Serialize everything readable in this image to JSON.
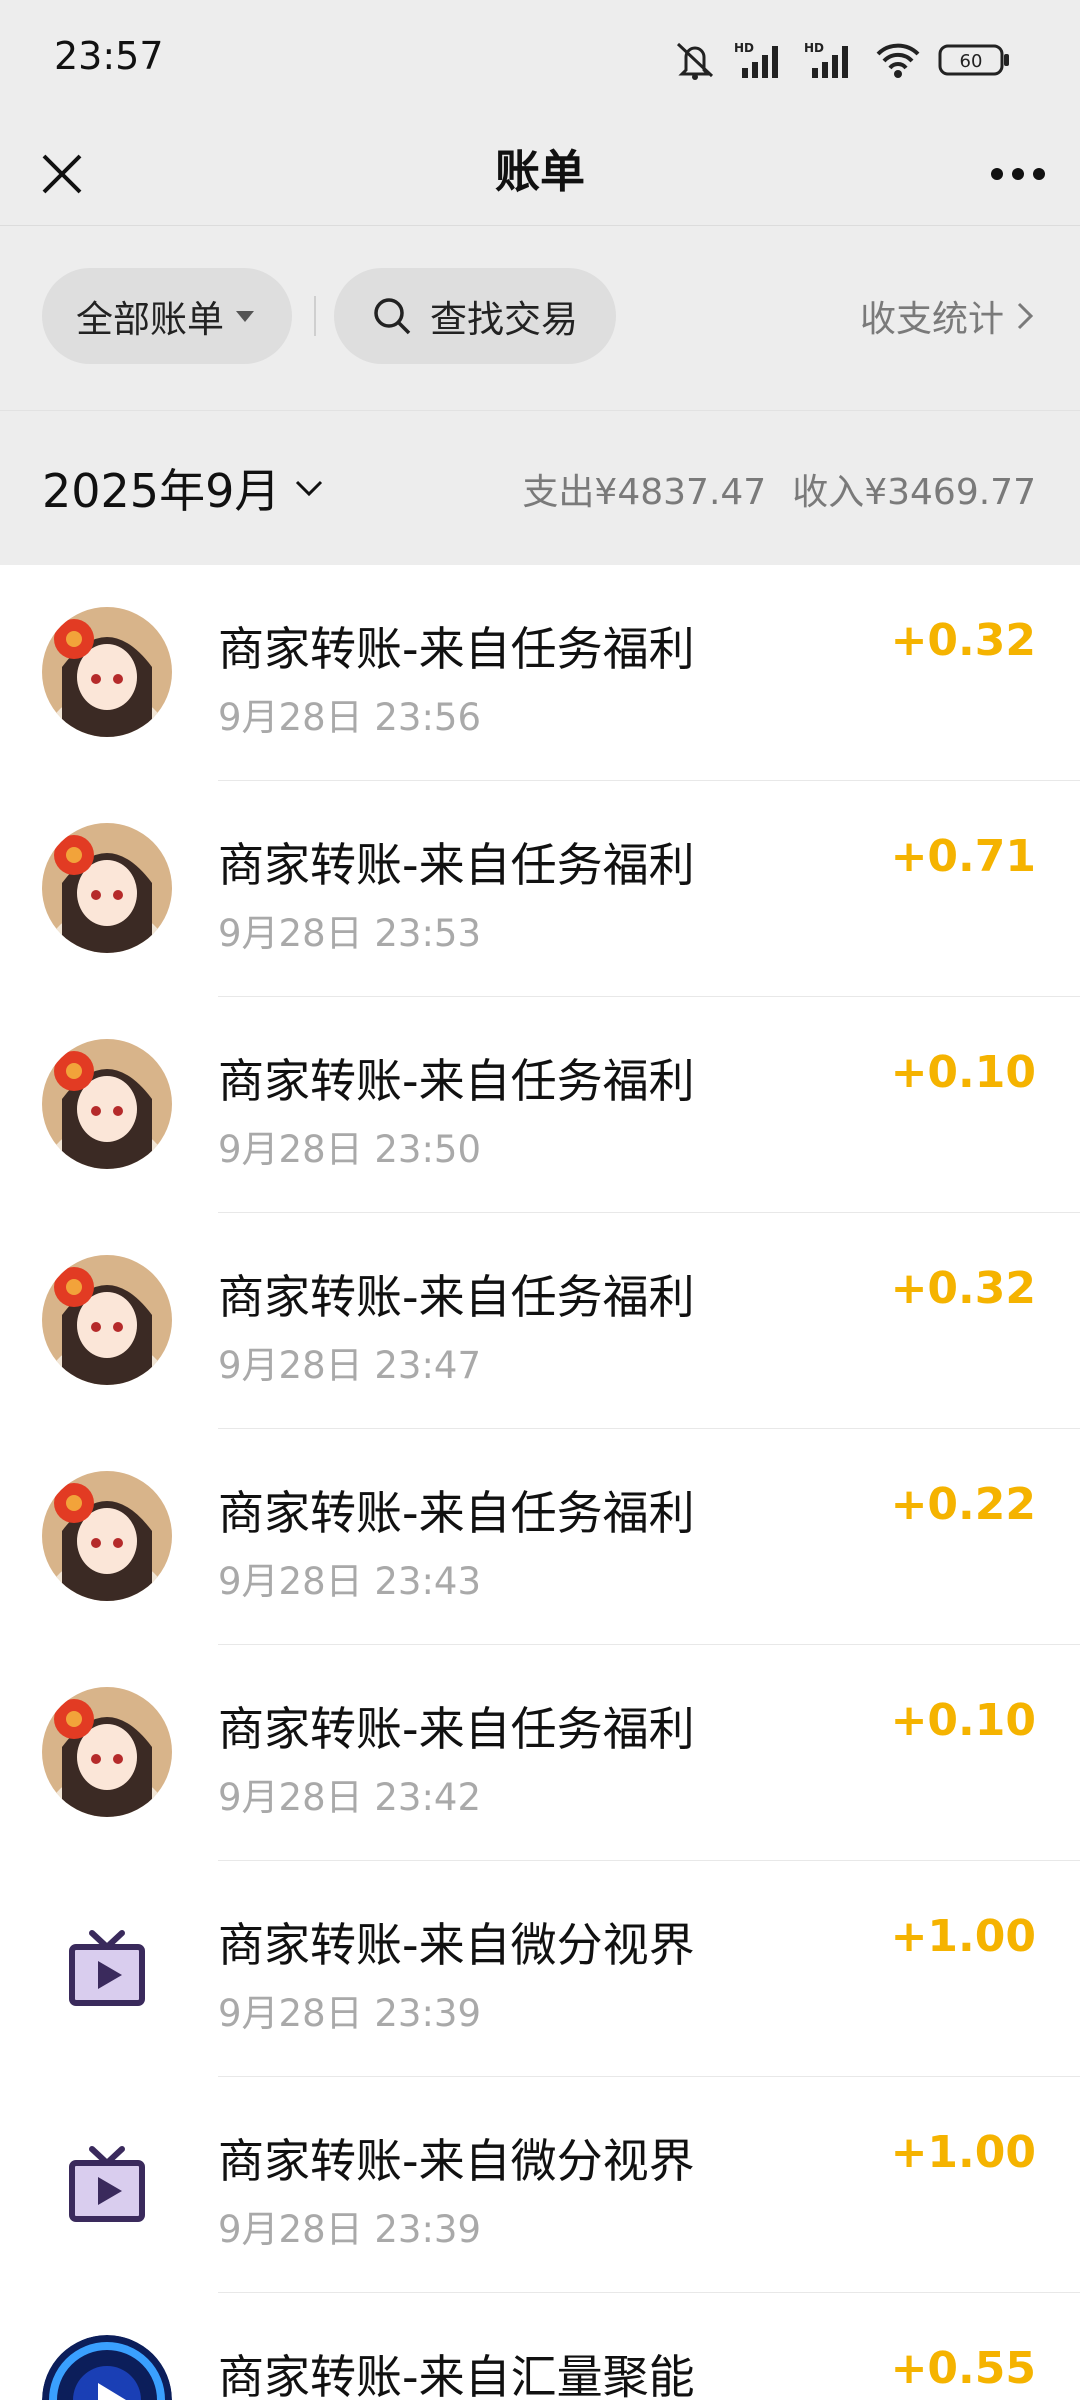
{
  "status_bar": {
    "time": "23:57",
    "battery": "60",
    "network_label_1": "HD",
    "network_label_2": "HD",
    "icons": [
      "mute-icon",
      "signal-hd-icon",
      "signal-hd-icon",
      "wifi-icon",
      "battery-icon"
    ]
  },
  "nav": {
    "title": "账单",
    "close_icon": "close-icon",
    "more_icon": "more-icon"
  },
  "filters": {
    "all_bills_label": "全部账单",
    "search_label": "查找交易",
    "stats_label": "收支统计"
  },
  "summary": {
    "month_label": "2025年9月",
    "expense_label": "支出",
    "expense_value": "¥4837.47",
    "income_label": "收入",
    "income_value": "¥3469.77"
  },
  "transactions": [
    {
      "title": "商家转账-来自任务福利",
      "time": "9月28日 23:56",
      "amount": "+0.32",
      "avatar": "character-avatar"
    },
    {
      "title": "商家转账-来自任务福利",
      "time": "9月28日 23:53",
      "amount": "+0.71",
      "avatar": "character-avatar"
    },
    {
      "title": "商家转账-来自任务福利",
      "time": "9月28日 23:50",
      "amount": "+0.10",
      "avatar": "character-avatar"
    },
    {
      "title": "商家转账-来自任务福利",
      "time": "9月28日 23:47",
      "amount": "+0.32",
      "avatar": "character-avatar"
    },
    {
      "title": "商家转账-来自任务福利",
      "time": "9月28日 23:43",
      "amount": "+0.22",
      "avatar": "character-avatar"
    },
    {
      "title": "商家转账-来自任务福利",
      "time": "9月28日 23:42",
      "amount": "+0.10",
      "avatar": "character-avatar"
    },
    {
      "title": "商家转账-来自微分视界",
      "time": "9月28日 23:39",
      "amount": "+1.00",
      "avatar": "tv-play-icon"
    },
    {
      "title": "商家转账-来自微分视界",
      "time": "9月28日 23:39",
      "amount": "+1.00",
      "avatar": "tv-play-icon"
    },
    {
      "title": "商家转账-来自汇量聚能",
      "time": "",
      "amount": "+0.55",
      "avatar": "blue-circle-logo"
    }
  ],
  "colors": {
    "income_amount": "#f5b300",
    "background_gray": "#ededed",
    "secondary_text": "#a9a9a9"
  }
}
